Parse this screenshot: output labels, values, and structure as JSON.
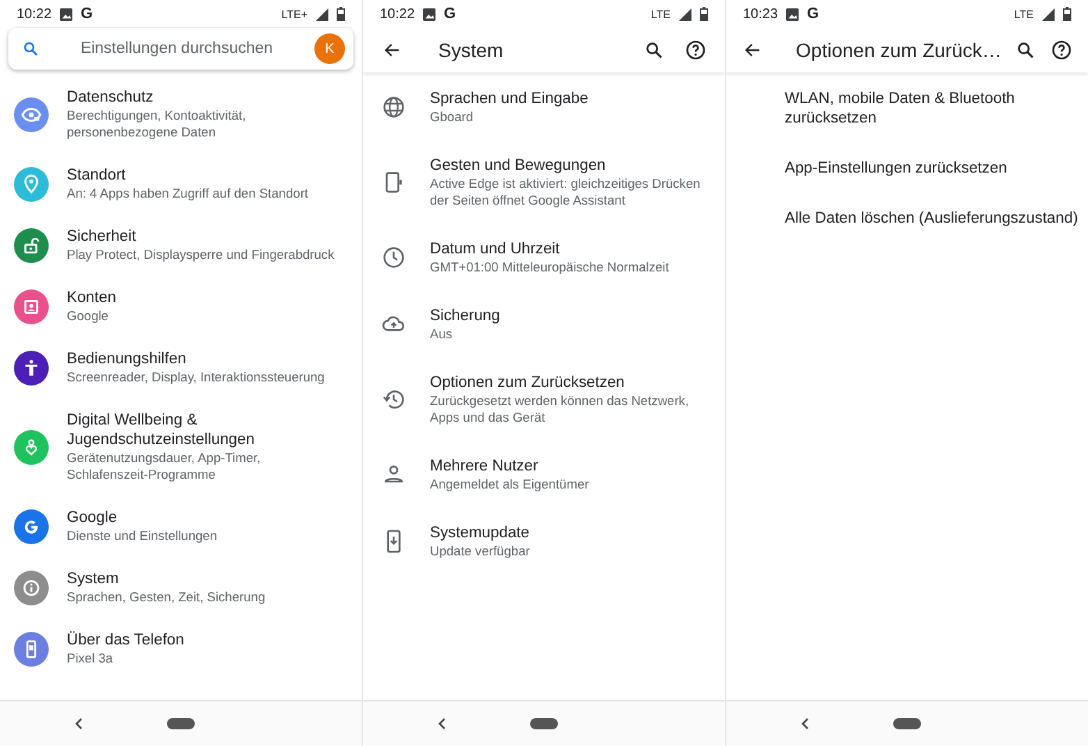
{
  "screens": [
    {
      "kind": "home",
      "status_bar": {
        "time": "10:22",
        "notification": "G",
        "network": "LTE+"
      },
      "search": {
        "placeholder": "Einstellungen durchsuchen",
        "avatar": "K"
      },
      "items": [
        {
          "title": "Datenschutz",
          "subtitle": "Berechtigungen, Kontoaktivität,\npersonenbezogene Daten",
          "color": "#6b8ff0"
        },
        {
          "title": "Standort",
          "subtitle": "An: 4 Apps haben Zugriff auf den Standort",
          "color": "#2cbcd8"
        },
        {
          "title": "Sicherheit",
          "subtitle": "Play Protect, Displaysperre und Fingerabdruck",
          "color": "#1e8e4e"
        },
        {
          "title": "Konten",
          "subtitle": "Google",
          "color": "#e9508c"
        },
        {
          "title": "Bedienungshilfen",
          "subtitle": "Screenreader, Display, Interaktionssteuerung",
          "color": "#4c1fb6"
        },
        {
          "title": "Digital Wellbeing &\nJugendschutzeinstellungen",
          "subtitle": "Gerätenutzungsdauer, App-Timer,\nSchlafenszeit-Programme",
          "color": "#1fc35e"
        },
        {
          "title": "Google",
          "subtitle": "Dienste und Einstellungen",
          "color": "#1a73e8"
        },
        {
          "title": "System",
          "subtitle": "Sprachen, Gesten, Zeit, Sicherung",
          "color": "#8d8d8d"
        },
        {
          "title": "Über das Telefon",
          "subtitle": "Pixel 3a",
          "color": "#6b7fe0"
        }
      ]
    },
    {
      "kind": "submenu",
      "status_bar": {
        "time": "10:22",
        "notification": "G",
        "network": "LTE"
      },
      "title": "System",
      "items": [
        {
          "title": "Sprachen und Eingabe",
          "subtitle": "Gboard"
        },
        {
          "title": "Gesten und Bewegungen",
          "subtitle": "Active Edge ist aktiviert: gleichzeitiges Drücken\nder Seiten öffnet Google Assistant"
        },
        {
          "title": "Datum und Uhrzeit",
          "subtitle": "GMT+01:00 Mitteleuropäische Normalzeit"
        },
        {
          "title": "Sicherung",
          "subtitle": "Aus"
        },
        {
          "title": "Optionen zum Zurücksetzen",
          "subtitle": "Zurückgesetzt werden können das Netzwerk,\nApps und das Gerät"
        },
        {
          "title": "Mehrere Nutzer",
          "subtitle": "Angemeldet als Eigentümer"
        },
        {
          "title": "Systemupdate",
          "subtitle": "Update verfügbar"
        }
      ]
    },
    {
      "kind": "submenu",
      "status_bar": {
        "time": "10:23",
        "notification": "G",
        "network": "LTE"
      },
      "title": "Optionen zum Zurück…",
      "items": [
        {
          "title": "WLAN, mobile Daten & Bluetooth\nzurücksetzen"
        },
        {
          "title": "App-Einstellungen zurücksetzen"
        },
        {
          "title": "Alle Daten löschen (Auslieferungszustand)"
        }
      ]
    }
  ]
}
